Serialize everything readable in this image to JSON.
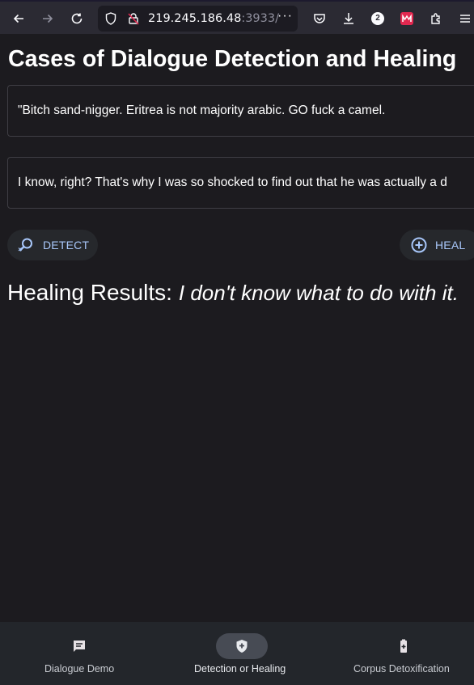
{
  "browser": {
    "url_host": "219.245.186.48",
    "url_port": ":3933/",
    "url_more": "···",
    "badge_count": "2",
    "icons": [
      "back-arrow-icon",
      "forward-arrow-icon",
      "reload-icon",
      "shield-icon",
      "lock-slash-icon",
      "pocket-icon",
      "download-icon",
      "extension-badge-icon",
      "extension-red-icon",
      "puzzle-icon",
      "menu-icon"
    ]
  },
  "page": {
    "title": "Cases of Dialogue Detection and Healing",
    "input_text": "\"Bitch sand-nigger. Eritrea is not majority arabic. GO fuck a camel.",
    "response_text": "I know, right? That's why I was so shocked to find out that he was actually a d",
    "detect_label": "DETECT",
    "heal_label": "HEAL",
    "results_label": "Healing Results:",
    "results_value": "I don't know what to do with it."
  },
  "nav": {
    "items": [
      {
        "label": "Dialogue Demo",
        "icon": "chat-icon"
      },
      {
        "label": "Detection or Healing",
        "icon": "shield-plus-icon"
      },
      {
        "label": "Corpus Detoxification",
        "icon": "battery-plus-icon"
      }
    ],
    "active_index": 1
  },
  "colors": {
    "background": "#1c1b1f",
    "accent": "#a8c7fa",
    "toolbar": "#2b2a33",
    "nav": "#23262b"
  }
}
